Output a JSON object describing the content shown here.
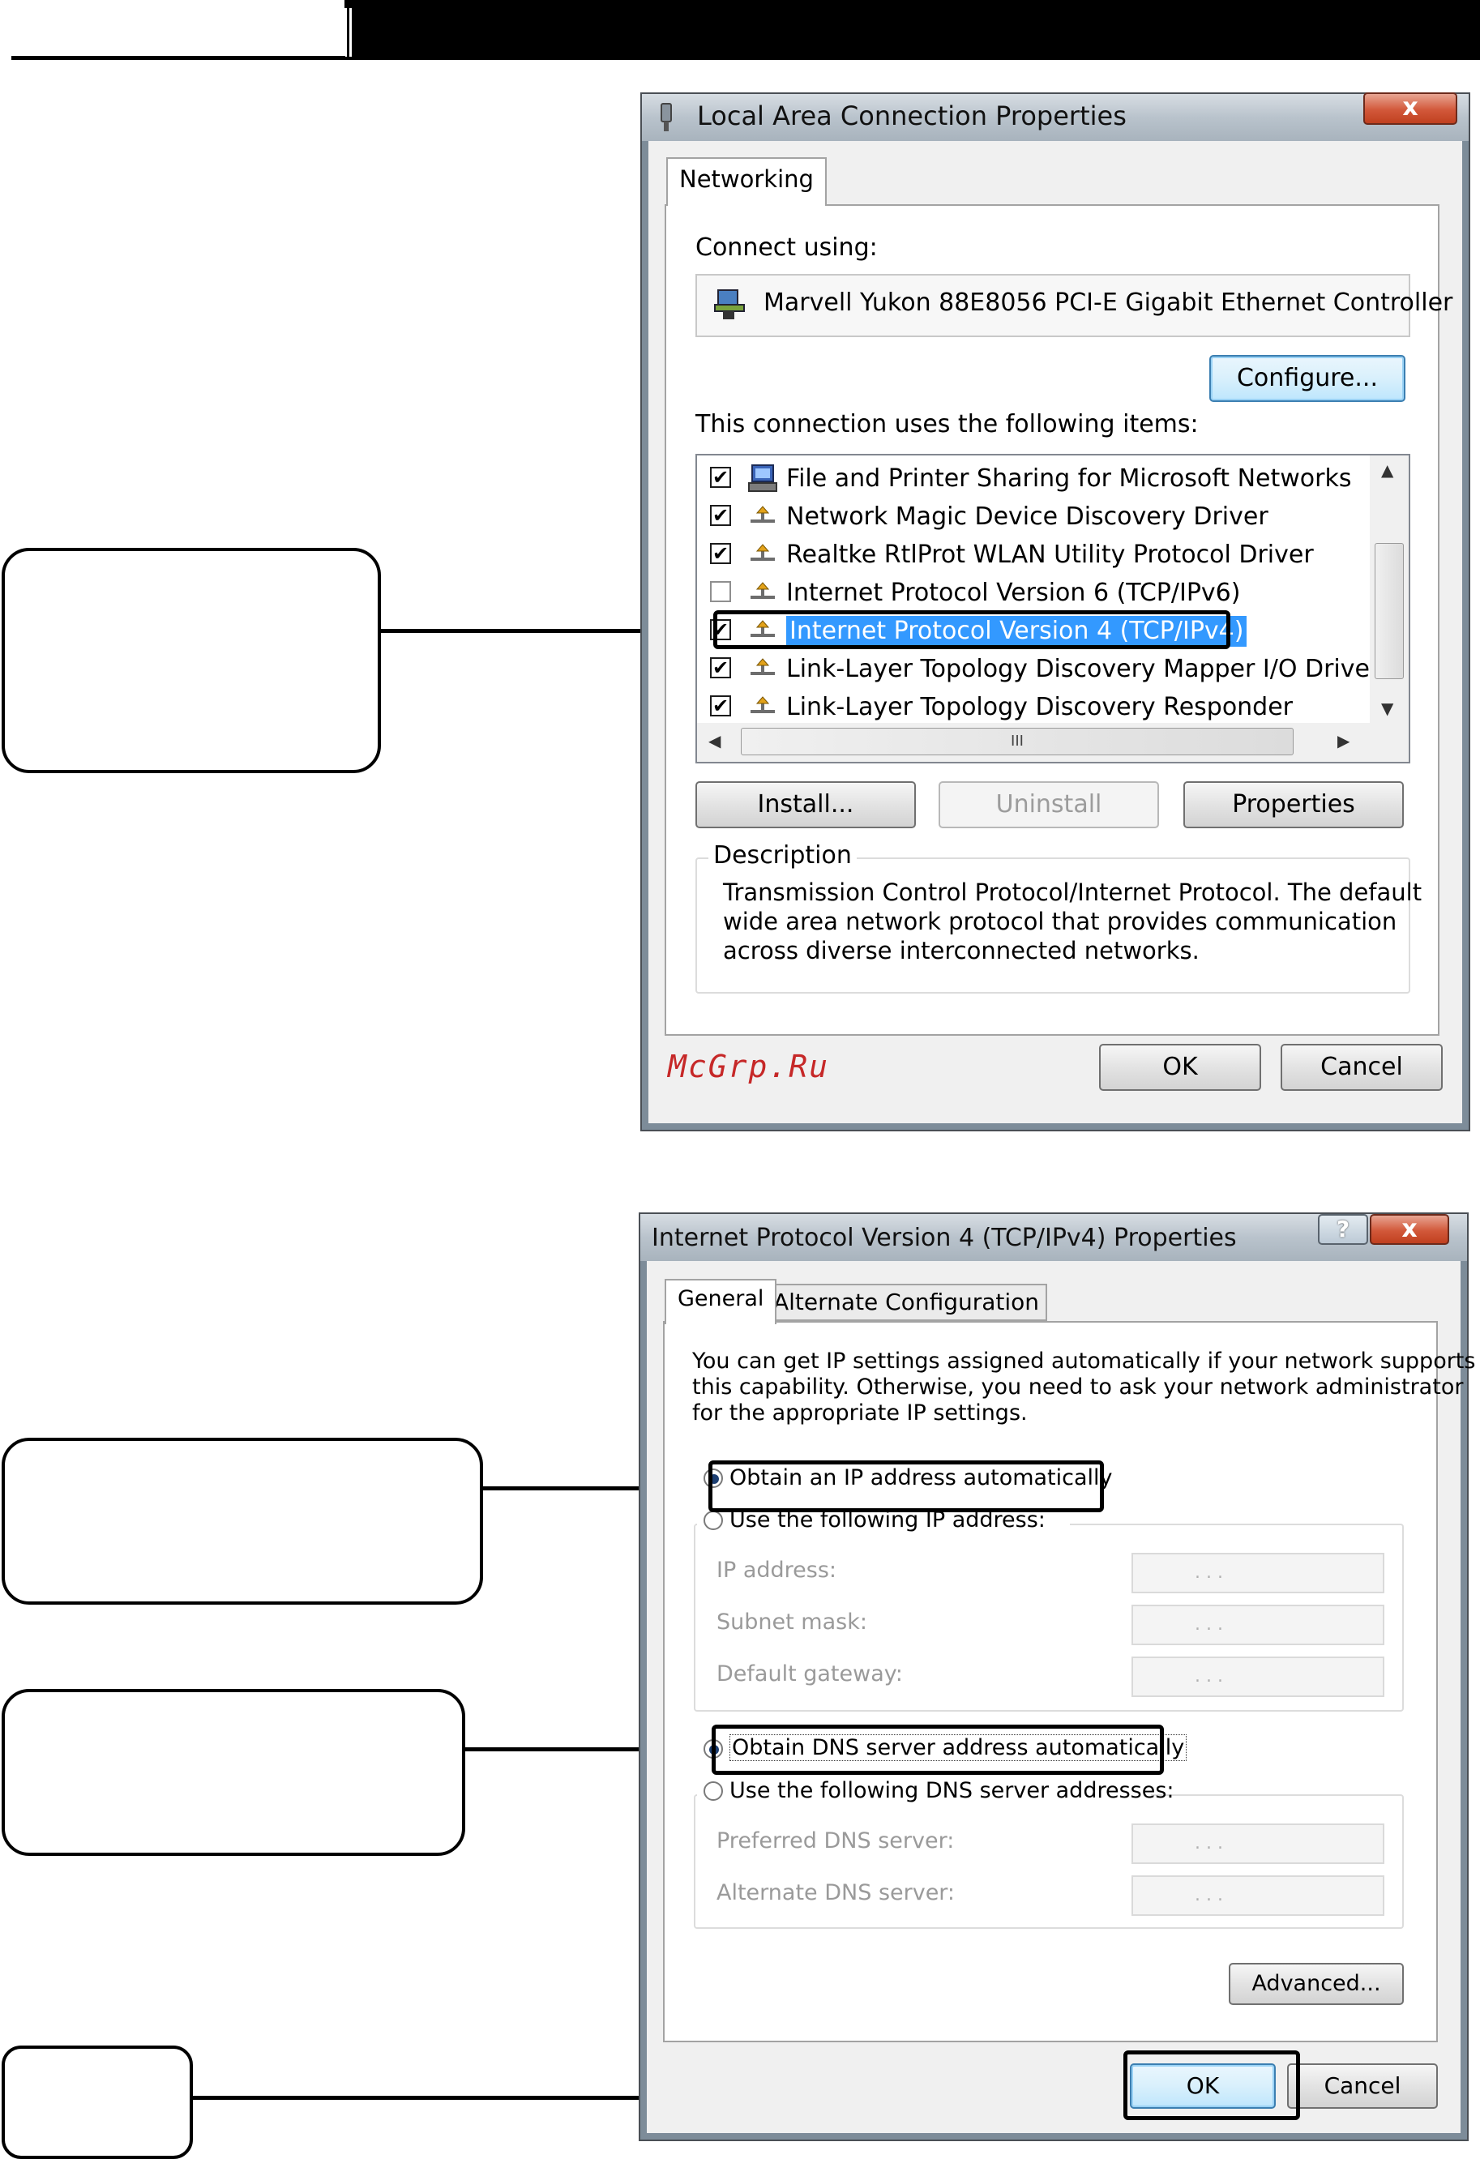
{
  "dialog1": {
    "title": "Local Area Connection Properties",
    "close": "x",
    "tab": "Networking",
    "connect_using_label": "Connect using:",
    "adapter_name": "Marvell Yukon 88E8056 PCI-E Gigabit Ethernet Controller",
    "configure_label": "Configure...",
    "items_label": "This connection uses the following items:",
    "items": [
      {
        "label": "File and Printer Sharing for Microsoft Networks",
        "checked": true,
        "icon": "network-client-icon"
      },
      {
        "label": "Network Magic Device Discovery Driver",
        "checked": true,
        "icon": "protocol-icon"
      },
      {
        "label": "Realtke RtlProt WLAN Utility Protocol Driver",
        "checked": true,
        "icon": "protocol-icon"
      },
      {
        "label": "Internet Protocol Version 6 (TCP/IPv6)",
        "checked": false,
        "icon": "protocol-icon"
      },
      {
        "label": "Internet Protocol Version 4 (TCP/IPv4)",
        "checked": true,
        "icon": "protocol-icon",
        "selected": true
      },
      {
        "label": "Link-Layer Topology Discovery Mapper I/O Driver",
        "checked": true,
        "icon": "protocol-icon"
      },
      {
        "label": "Link-Layer Topology Discovery Responder",
        "checked": true,
        "icon": "protocol-icon"
      }
    ],
    "scroll_grip": "III",
    "install_label": "Install...",
    "uninstall_label": "Uninstall",
    "properties_label": "Properties",
    "description_label": "Description",
    "description_line1": "Transmission Control Protocol/Internet Protocol. The default",
    "description_line2": "wide area network protocol that provides communication",
    "description_line3": "across diverse interconnected networks.",
    "ok_label": "OK",
    "cancel_label": "Cancel"
  },
  "watermark": "McGrp.Ru",
  "dialog2": {
    "title": "Internet Protocol Version 4 (TCP/IPv4) Properties",
    "help": "?",
    "close": "x",
    "tab_general": "General",
    "tab_alternate": "Alternate Configuration",
    "intro_line1": "You can get IP settings assigned automatically if your network supports",
    "intro_line2": "this capability. Otherwise, you need to ask your network administrator",
    "intro_line3": "for the appropriate IP settings.",
    "radio_auto_ip": "Obtain an IP address automatically",
    "radio_manual_ip": "Use the following IP address:",
    "ip_address_label": "IP address:",
    "subnet_mask_label": "Subnet mask:",
    "default_gateway_label": "Default gateway:",
    "radio_auto_dns": "Obtain DNS server address automatically",
    "radio_manual_dns": "Use the following DNS server addresses:",
    "preferred_dns_label": "Preferred DNS server:",
    "alternate_dns_label": "Alternate DNS server:",
    "ip_dots": ".        .        .",
    "advanced_label": "Advanced...",
    "ok_label": "OK",
    "cancel_label": "Cancel"
  },
  "colors": {
    "selection": "#3399ff",
    "watermark": "#c62828",
    "close_button": "#d2583a"
  }
}
